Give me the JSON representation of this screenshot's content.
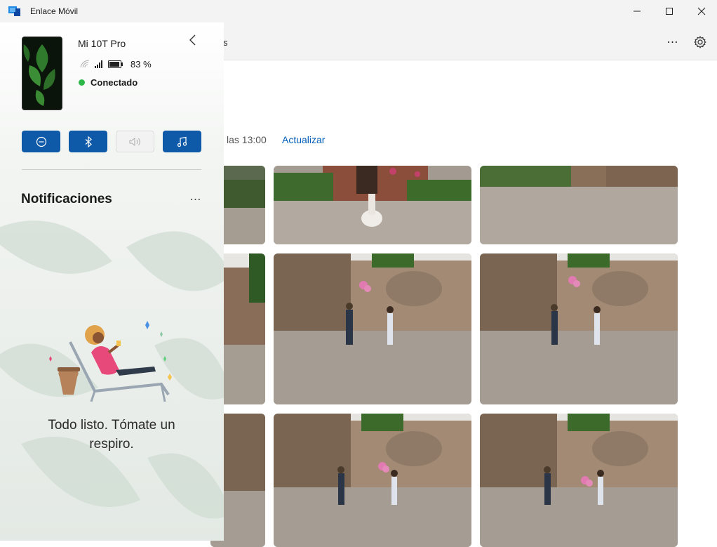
{
  "window": {
    "title": "Enlace Móvil",
    "controls": [
      "minimize-icon",
      "maximize-icon",
      "close-icon"
    ]
  },
  "header": {
    "tab_partial": "s",
    "more_label": "⋯",
    "settings_icon": "gear-icon"
  },
  "content": {
    "sync_text": "las 13:00",
    "refresh_label": "Actualizar",
    "photos_visible": 9
  },
  "device": {
    "name": "Mi 10T Pro",
    "battery": "83 %",
    "connection": "Conectado",
    "connection_color": "#2eb84a"
  },
  "quick_actions": [
    {
      "icon": "do-not-disturb-icon",
      "enabled": true
    },
    {
      "icon": "bluetooth-icon",
      "enabled": true
    },
    {
      "icon": "volume-icon",
      "enabled": false
    },
    {
      "icon": "music-note-icon",
      "enabled": true
    }
  ],
  "notifications": {
    "title": "Notificaciones",
    "more_label": "⋯",
    "empty_message": "Todo listo. Tómate un respiro."
  },
  "colors": {
    "accent": "#0f5aa8",
    "link": "#005fb8"
  }
}
